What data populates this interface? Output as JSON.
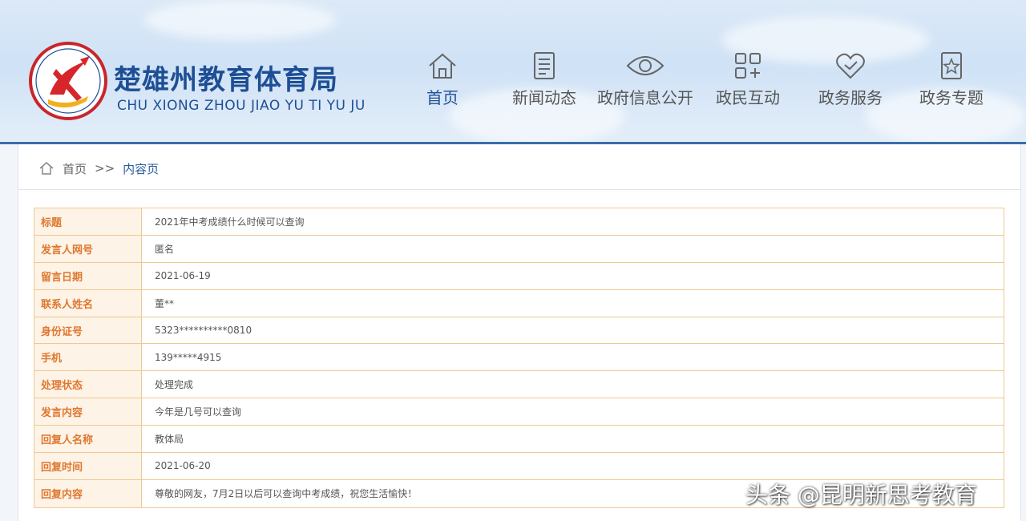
{
  "header": {
    "site_title": "楚雄州教育体育局",
    "site_subtitle": "CHU XIONG ZHOU JIAO YU TI YU JU",
    "colors": {
      "brand": "#1e4f95",
      "accent_line": "#3a6ea8",
      "logo_red": "#c7262b"
    }
  },
  "nav": [
    {
      "label": "首页",
      "icon": "home-icon",
      "active": true
    },
    {
      "label": "新闻动态",
      "icon": "document-icon"
    },
    {
      "label": "政府信息公开",
      "icon": "eye-icon"
    },
    {
      "label": "政民互动",
      "icon": "grid-icon"
    },
    {
      "label": "政务服务",
      "icon": "heart-icon"
    },
    {
      "label": "政务专题",
      "icon": "star-doc-icon"
    }
  ],
  "breadcrumb": {
    "home": "首页",
    "separator": ">>",
    "current": "内容页"
  },
  "table": {
    "rows": [
      {
        "label": "标题",
        "value": "2021年中考成绩什么时候可以查询"
      },
      {
        "label": "发言人网号",
        "value": "匿名"
      },
      {
        "label": "留言日期",
        "value": "2021-06-19"
      },
      {
        "label": "联系人姓名",
        "value": "董**"
      },
      {
        "label": "身份证号",
        "value": "5323**********0810"
      },
      {
        "label": "手机",
        "value": "139*****4915"
      },
      {
        "label": "处理状态",
        "value": "处理完成"
      },
      {
        "label": "发言内容",
        "value": "今年是几号可以查询"
      },
      {
        "label": "回复人名称",
        "value": "教体局"
      },
      {
        "label": "回复时间",
        "value": "2021-06-20"
      },
      {
        "label": "回复内容",
        "value": "尊敬的网友，7月2日以后可以查询中考成绩，祝您生活愉快！"
      }
    ],
    "colors": {
      "label_text": "#e0772f",
      "label_bg": "#fdf3e6",
      "border": "#f0c890"
    }
  },
  "watermark": "头条 @昆明新思考教育"
}
